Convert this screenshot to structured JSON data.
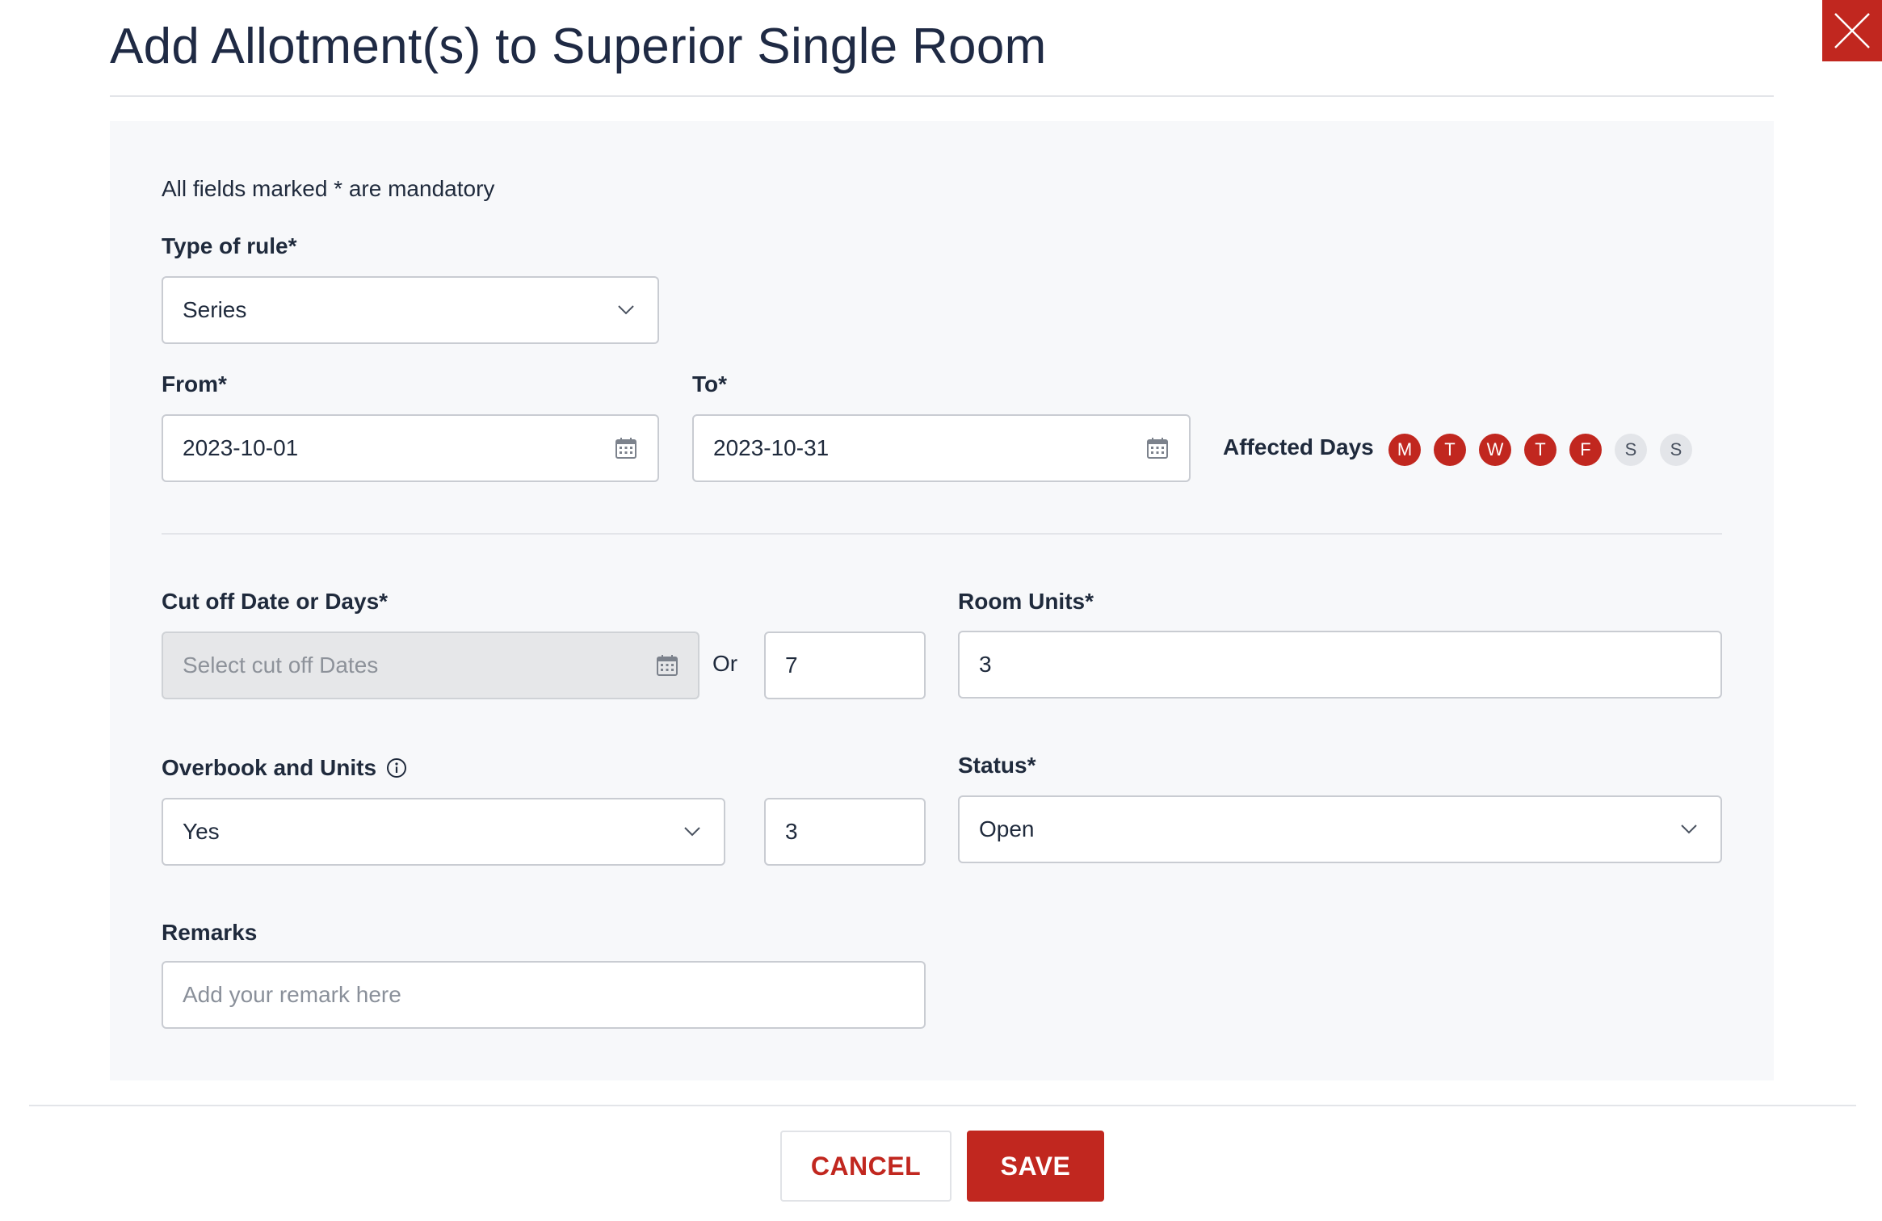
{
  "modal": {
    "title": "Add Allotment(s) to Superior Single Room",
    "close_icon": "close-icon"
  },
  "form": {
    "mandatory_note": "All fields marked * are mandatory",
    "rule_type": {
      "label": "Type of rule*",
      "value": "Series"
    },
    "from": {
      "label": "From*",
      "value": "2023-10-01"
    },
    "to": {
      "label": "To*",
      "value": "2023-10-31"
    },
    "affected_days": {
      "label": "Affected Days",
      "days": [
        {
          "letter": "M",
          "active": true
        },
        {
          "letter": "T",
          "active": true
        },
        {
          "letter": "W",
          "active": true
        },
        {
          "letter": "T",
          "active": true
        },
        {
          "letter": "F",
          "active": true
        },
        {
          "letter": "S",
          "active": false
        },
        {
          "letter": "S",
          "active": false
        }
      ]
    },
    "cutoff": {
      "label": "Cut off Date or Days*",
      "date_placeholder": "Select cut off Dates",
      "or_text": "Or",
      "days_value": "7"
    },
    "room_units": {
      "label": "Room Units*",
      "value": "3"
    },
    "overbook": {
      "label": "Overbook and Units",
      "value": "Yes",
      "units": "3"
    },
    "status": {
      "label": "Status*",
      "value": "Open"
    },
    "remarks": {
      "label": "Remarks",
      "placeholder": "Add your remark here"
    }
  },
  "footer": {
    "cancel_label": "CANCEL",
    "save_label": "SAVE"
  },
  "colors": {
    "accent": "#c1271f",
    "panel": "#f7f8fa",
    "inactive_day": "#e3e5e9"
  }
}
